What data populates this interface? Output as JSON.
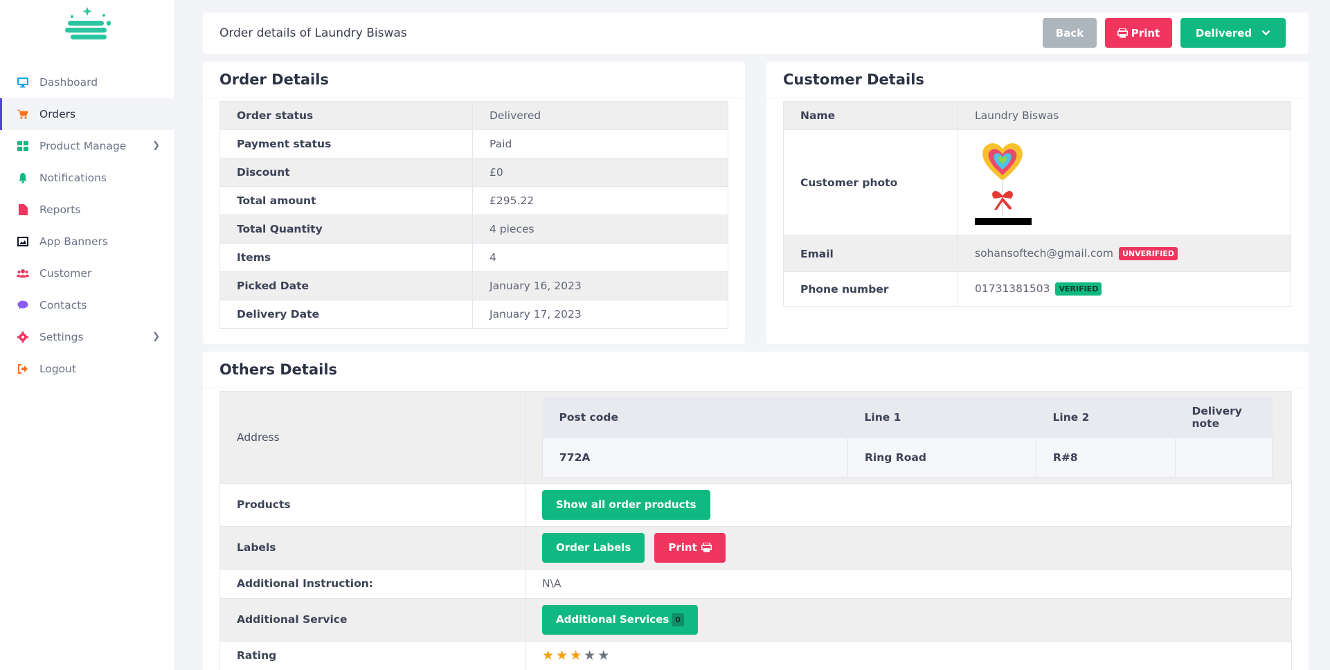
{
  "sidebar": {
    "items": [
      {
        "label": "Dashboard",
        "icon": "monitor-icon",
        "color": "#0ea5e9"
      },
      {
        "label": "Orders",
        "icon": "cart-icon",
        "color": "#f97316"
      },
      {
        "label": "Product Manage",
        "icon": "grid-icon",
        "color": "#10b981"
      },
      {
        "label": "Notifications",
        "icon": "bell-icon",
        "color": "#10b981"
      },
      {
        "label": "Reports",
        "icon": "file-icon",
        "color": "#f0355f"
      },
      {
        "label": "App Banners",
        "icon": "image-icon",
        "color": "#111827"
      },
      {
        "label": "Customer",
        "icon": "users-icon",
        "color": "#f0355f"
      },
      {
        "label": "Contacts",
        "icon": "chat-icon",
        "color": "#8b5cf6"
      },
      {
        "label": "Settings",
        "icon": "gear-icon",
        "color": "#f0355f"
      },
      {
        "label": "Logout",
        "icon": "logout-icon",
        "color": "#f97316"
      }
    ]
  },
  "header": {
    "title": "Order details of Laundry Biswas",
    "back_label": "Back",
    "print_label": "Print",
    "status_label": "Delivered"
  },
  "order_details": {
    "title": "Order Details",
    "rows": [
      {
        "label": "Order status",
        "value": "Delivered"
      },
      {
        "label": "Payment status",
        "value": "Paid"
      },
      {
        "label": "Discount",
        "value": "£0"
      },
      {
        "label": "Total amount",
        "value": "£295.22"
      },
      {
        "label": "Total Quantity",
        "value": "4 pieces"
      },
      {
        "label": "Items",
        "value": "4"
      },
      {
        "label": "Picked Date",
        "value": "January 16, 2023"
      },
      {
        "label": "Delivery Date",
        "value": "January 17, 2023"
      }
    ]
  },
  "customer_details": {
    "title": "Customer Details",
    "name_label": "Name",
    "name_value": "Laundry Biswas",
    "photo_label": "Customer photo",
    "email_label": "Email",
    "email_value": "sohansoftech@gmail.com",
    "email_badge": "UNVERIFIED",
    "phone_label": "Phone number",
    "phone_value": "01731381503",
    "phone_badge": "VERIFIED"
  },
  "others_details": {
    "title": "Others Details",
    "address_label": "Address",
    "address_headers": [
      "Post code",
      "Line 1",
      "Line 2",
      "Delivery note"
    ],
    "address_values": [
      "772A",
      "Ring Road",
      "R#8",
      ""
    ],
    "products_label": "Products",
    "products_button": "Show all order products",
    "labels_label": "Labels",
    "order_labels_button": "Order Labels",
    "labels_print_button": "Print",
    "instruction_label": "Additional Instruction:",
    "instruction_value": "N\\A",
    "service_label": "Additional Service",
    "service_button": "Additional Services",
    "service_count": "0",
    "rating_label": "Rating",
    "rating": 3,
    "rating_max": 5
  }
}
